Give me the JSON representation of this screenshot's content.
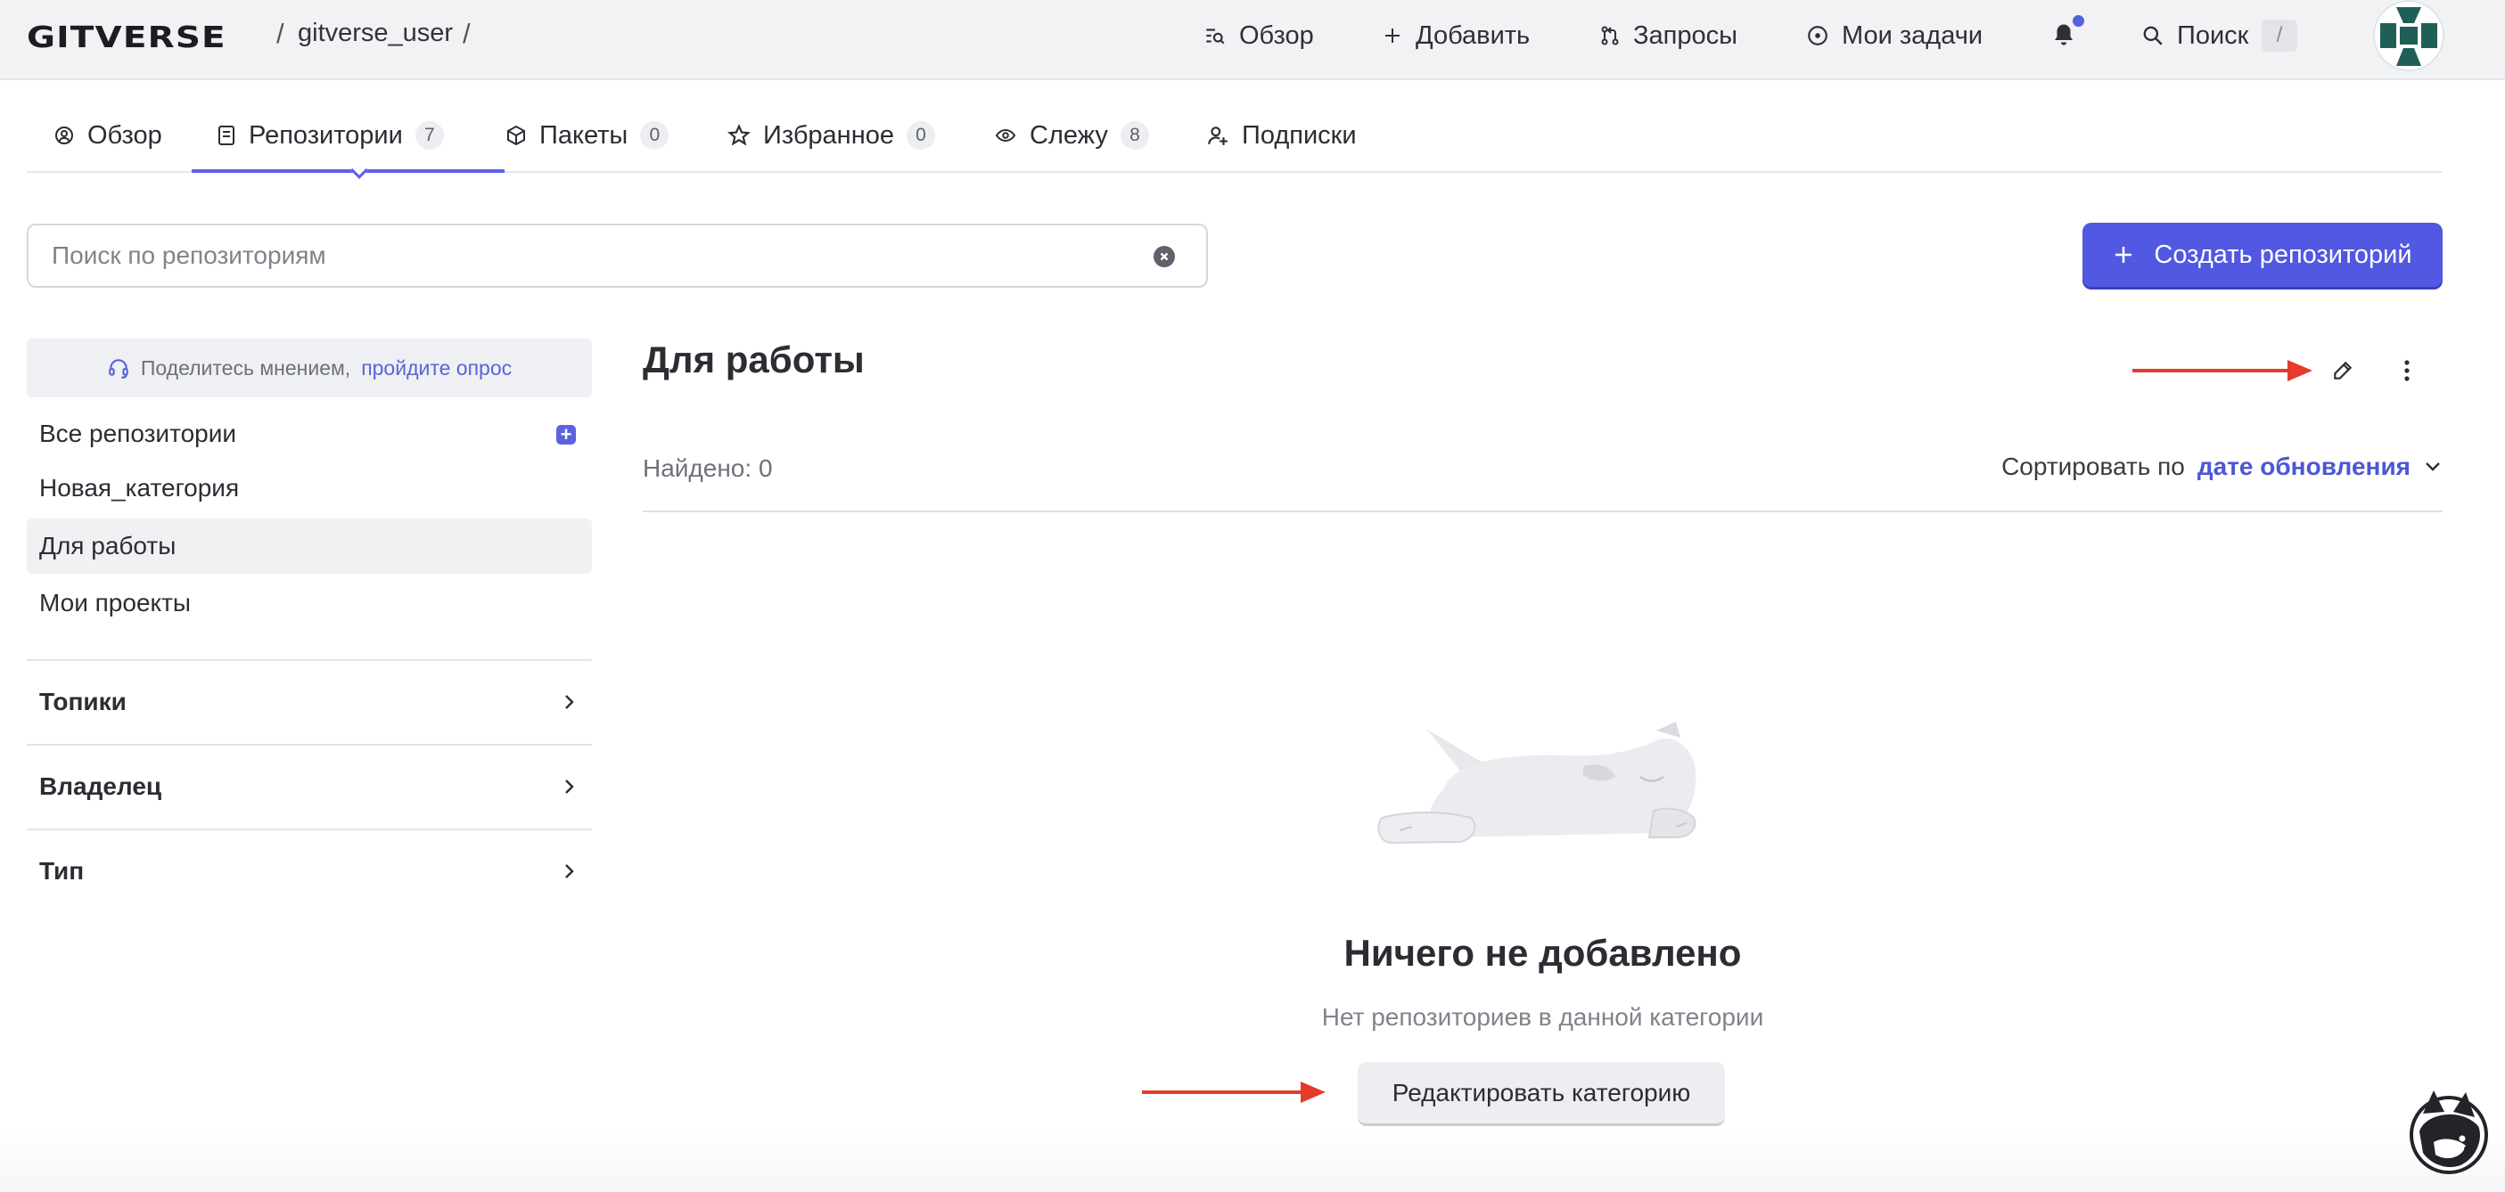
{
  "header": {
    "logo": "GITVERSE",
    "separator": "/",
    "username": "gitverse_user",
    "nav": [
      {
        "label": "Обзор",
        "icon": "overview-icon"
      },
      {
        "label": "Добавить",
        "icon": "plus-icon"
      },
      {
        "label": "Запросы",
        "icon": "pull-request-icon"
      },
      {
        "label": "Мои задачи",
        "icon": "issue-icon"
      }
    ],
    "notifications_icon": "bell-icon",
    "search_label": "Поиск",
    "search_shortcut": "/"
  },
  "tabs": [
    {
      "label": "Обзор",
      "icon": "overview-circle-icon"
    },
    {
      "label": "Репозитории",
      "icon": "repo-icon",
      "count": "7",
      "active": true
    },
    {
      "label": "Пакеты",
      "icon": "package-icon",
      "count": "0"
    },
    {
      "label": "Избранное",
      "icon": "star-icon",
      "count": "0"
    },
    {
      "label": "Слежу",
      "icon": "eye-icon",
      "count": "8"
    },
    {
      "label": "Подписки",
      "icon": "person-plus-icon"
    }
  ],
  "repo_search": {
    "placeholder": "Поиск по репозиториям",
    "value": ""
  },
  "create_button": {
    "label": "Создать репозиторий"
  },
  "sidebar": {
    "survey": {
      "text": "Поделитесь мнением,",
      "link": "пройдите опрос"
    },
    "categories": [
      {
        "label": "Все репозитории"
      },
      {
        "label": "Новая_категория"
      },
      {
        "label": "Для работы",
        "active": true
      },
      {
        "label": "Мои проекты"
      }
    ],
    "filters": [
      {
        "label": "Топики"
      },
      {
        "label": "Владелец"
      },
      {
        "label": "Тип"
      }
    ]
  },
  "main": {
    "title": "Для работы",
    "found": "Найдено: 0",
    "sort_label": "Сортировать по",
    "sort_value": "дате обновления",
    "empty_title": "Ничего не добавлено",
    "empty_subtitle": "Нет репозиториев в данной категории",
    "edit_button": "Редактировать категорию"
  },
  "colors": {
    "accent": "#5158e1",
    "annotation_arrow": "#e53b2a",
    "header_bg": "#f1f2f4"
  }
}
